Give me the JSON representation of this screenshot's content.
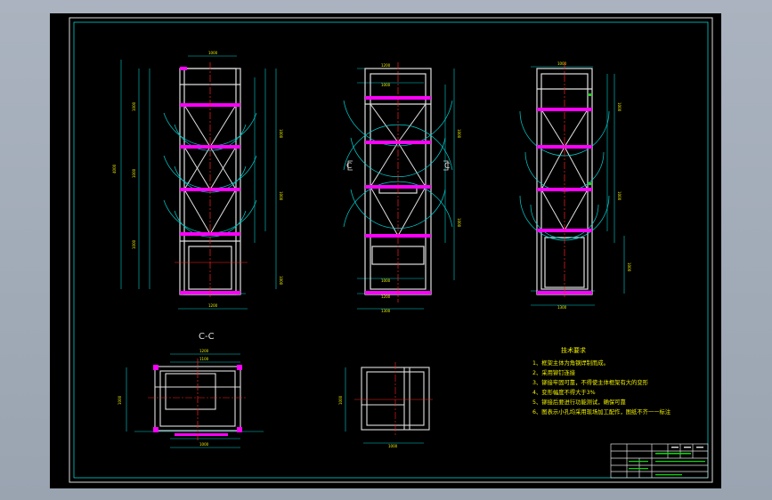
{
  "section_label": "C-C",
  "section_mark_left": "C",
  "section_mark_right": "C",
  "requirements": {
    "title": "技术要求",
    "items": [
      "1、框架主体为角钢焊制而成。",
      "2、采用铆钉连接",
      "3、铆接牢固可靠，不得使主体框架有大的变形",
      "4、变形幅度不得大于3%",
      "5、铆接后要进行功能测试，确保可靠",
      "6、图表示小孔均采用现场加工配作，图纸不齐一一标注"
    ]
  },
  "colors": {
    "frame": "#e8e8e8",
    "yellow": "#e8e800",
    "magenta": "#ff00ff",
    "red": "#ff2020",
    "cyan": "#00d0d0",
    "green": "#00e000"
  }
}
